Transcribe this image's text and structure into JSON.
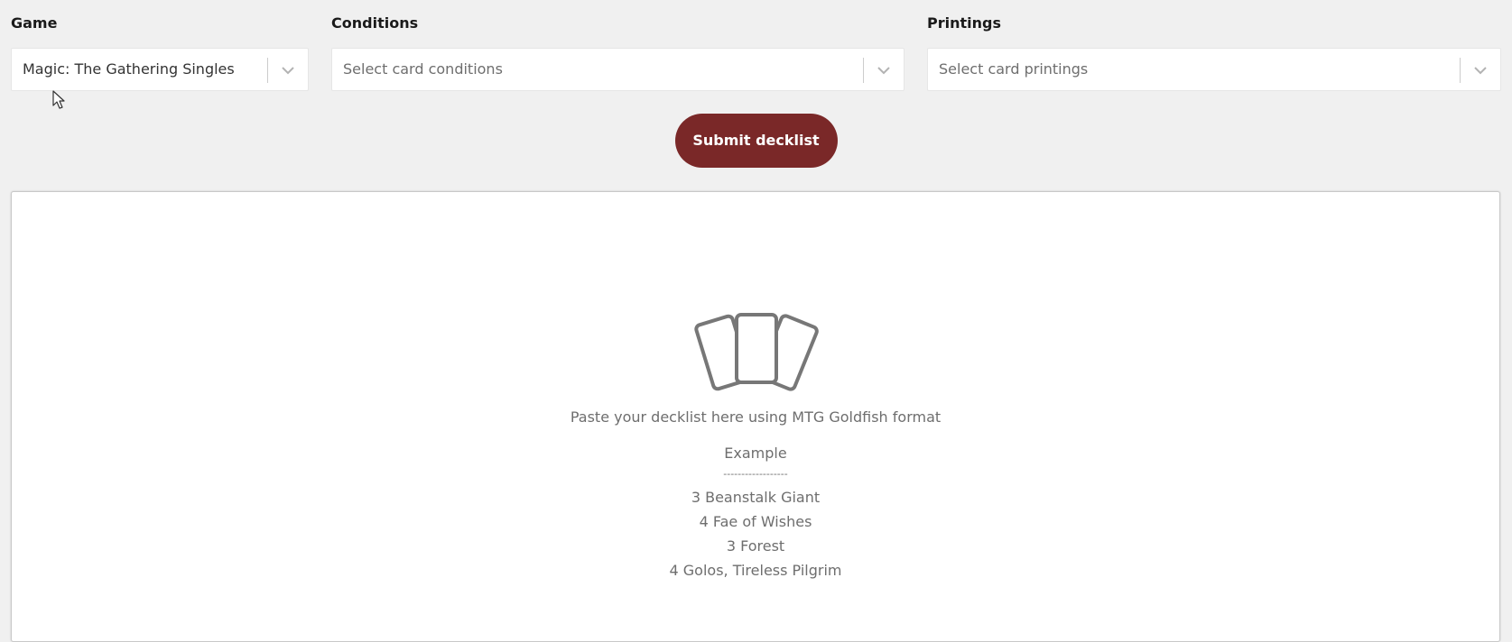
{
  "filters": {
    "game": {
      "label": "Game",
      "value": "Magic: The Gathering Singles"
    },
    "conditions": {
      "label": "Conditions",
      "placeholder": "Select card conditions"
    },
    "printings": {
      "label": "Printings",
      "placeholder": "Select card printings"
    }
  },
  "submit": {
    "label": "Submit decklist"
  },
  "decklist": {
    "icon": "cards-icon",
    "instruction": "Paste your decklist here using MTG Goldfish format",
    "example_title": "Example",
    "example_divider": "------------------",
    "example_lines": [
      "3 Beanstalk Giant",
      "4 Fae of Wishes",
      "3 Forest",
      "4 Golos, Tireless Pilgrim"
    ]
  },
  "colors": {
    "page_background": "#f0f0f0",
    "submit_button": "#7a2828",
    "muted_text": "#6e6e6e",
    "icon_stroke": "#777777"
  }
}
